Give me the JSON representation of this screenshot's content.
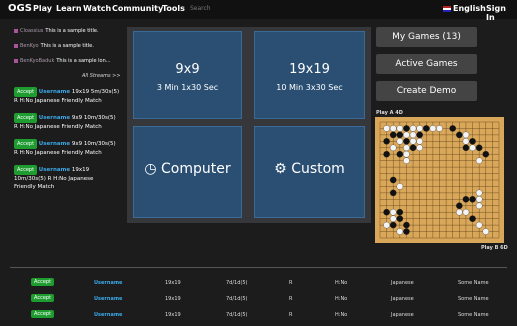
{
  "nav": {
    "logo": "OGS",
    "items": [
      "Play",
      "Learn",
      "Watch",
      "Community",
      "Tools"
    ],
    "search_placeholder": "Search",
    "language": "English",
    "sign_in": "Sign In"
  },
  "streams": [
    {
      "name": "Cloassius",
      "title": "This is a sample title."
    },
    {
      "name": "BenKyo",
      "title": "This is a sample title."
    },
    {
      "name": "BenKyoBaduk",
      "title": "This is a sample lon..."
    }
  ],
  "all_streams": "All Streams >>",
  "challenges": [
    {
      "accept": "Accept",
      "user": "Username",
      "l1": "19x19  5m/30s(5)",
      "l2": "R  H:No  Japanese  Friendly Match"
    },
    {
      "accept": "Accept",
      "user": "Username",
      "l1": "9x9  10m/30s(5)",
      "l2": "R  H:No  Japanese  Friendly Match"
    },
    {
      "accept": "Accept",
      "user": "Username",
      "l1": "9x9  10m/30s(5)",
      "l2": "R  H:No  Japanese  Friendly Match"
    },
    {
      "accept": "Accept",
      "user": "Username",
      "l1": "19x19",
      "l2": "10m/30s(5)  R  H:No  Japanese",
      "l3": "Friendly Match"
    }
  ],
  "quick": [
    {
      "title": "9x9",
      "sub": "3 Min 1x30 Sec"
    },
    {
      "title": "19x19",
      "sub": "10 Min 3x30 Sec"
    },
    {
      "title": "Computer",
      "icon": "clock-icon"
    },
    {
      "title": "Custom",
      "icon": "gear-icon"
    }
  ],
  "right_buttons": [
    "My Games (13)",
    "Active Games",
    "Create Demo"
  ],
  "players": {
    "top": "Play A 4D",
    "bottom": "Play B 6D"
  },
  "table_rows": [
    {
      "accept": "Accept",
      "user": "Username",
      "size": "19x19",
      "time": "7d/1d(5)",
      "r": "R",
      "h": "H:No",
      "rules": "Japanese",
      "name": "Some Name"
    },
    {
      "accept": "Accept",
      "user": "Username",
      "size": "19x19",
      "time": "7d/1d(5)",
      "r": "R",
      "h": "H:No",
      "rules": "Japanese",
      "name": "Some Name"
    },
    {
      "accept": "Accept",
      "user": "Username",
      "size": "19x19",
      "time": "7d/1d(5)",
      "r": "R",
      "h": "H:No",
      "rules": "Japanese",
      "name": "Some Name"
    }
  ],
  "colors": {
    "accent_green": "#1e9c30",
    "link_blue": "#3aa7e6",
    "card_blue": "#2a4f73",
    "board": "#d9a75a"
  }
}
